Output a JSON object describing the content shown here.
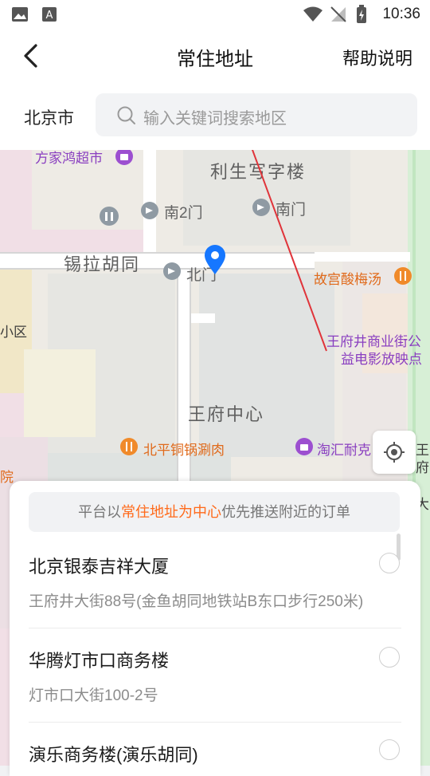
{
  "status_bar": {
    "time": "10:36"
  },
  "nav": {
    "title": "常住地址",
    "help": "帮助说明"
  },
  "search": {
    "city": "北京市",
    "placeholder": "输入关键词搜索地区"
  },
  "map": {
    "labels": {
      "supermarket": "方家鸿超市",
      "building": "利生写字楼",
      "south_gate2": "南2门",
      "south_gate": "南门",
      "hutong": "锡拉胡同",
      "north_gate": "北门",
      "soup": "故宫酸梅汤",
      "district": "小区",
      "cinema_line1": "王府井商业街公",
      "cinema_line2": "益电影放映点",
      "center": "王府中心",
      "hotpot": "北平铜锅涮肉",
      "taohui": "淘汇耐克",
      "right_edge1": "王",
      "right_edge2": "府",
      "right_edge3": "大",
      "left_edge": "院"
    }
  },
  "sheet": {
    "tip_prefix": "平台以",
    "tip_highlight": "常住地址为中心",
    "tip_suffix": "优先推送附近的订单",
    "items": [
      {
        "name": "北京银泰吉祥大厦",
        "address": "王府井大街88号(金鱼胡同地铁站B东口步行250米)"
      },
      {
        "name": "华腾灯市口商务楼",
        "address": "灯市口大街100-2号"
      },
      {
        "name": "演乐商务楼(演乐胡同)",
        "address": ""
      }
    ]
  },
  "colors": {
    "accent": "#ff6a1a",
    "pin": "#1677ff"
  }
}
